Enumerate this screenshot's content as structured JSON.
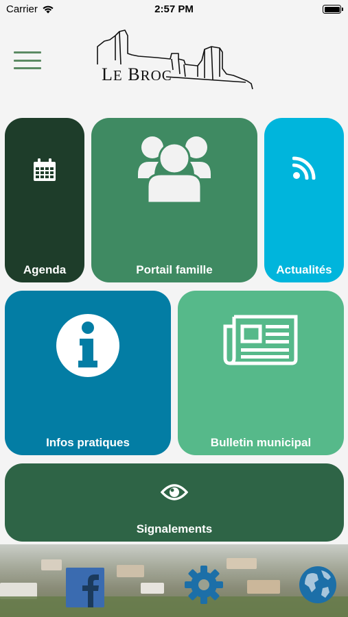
{
  "status_bar": {
    "carrier": "Carrier",
    "time": "2:57 PM"
  },
  "header": {
    "logo_text_first": "L",
    "logo_text_small1": "E",
    "logo_text_second": " B",
    "logo_text_small2": "ROC"
  },
  "tiles": {
    "agenda": "Agenda",
    "portail": "Portail famille",
    "actualites": "Actualités",
    "infos": "Infos pratiques",
    "bulletin": "Bulletin municipal",
    "signalements": "Signalements"
  },
  "colors": {
    "agenda": "#1e3d2a",
    "portail": "#3f8a62",
    "actualites": "#00b5dc",
    "infos": "#037da4",
    "bulletin": "#56b98a",
    "signalements": "#2e6446",
    "menu": "#5b8a63"
  },
  "icons": {
    "agenda": "calendar-icon",
    "portail": "group-users-icon",
    "actualites": "rss-icon",
    "infos": "info-icon",
    "bulletin": "newspaper-icon",
    "signalements": "eye-icon",
    "footer": [
      "facebook-icon",
      "gear-icon",
      "globe-icon"
    ]
  }
}
